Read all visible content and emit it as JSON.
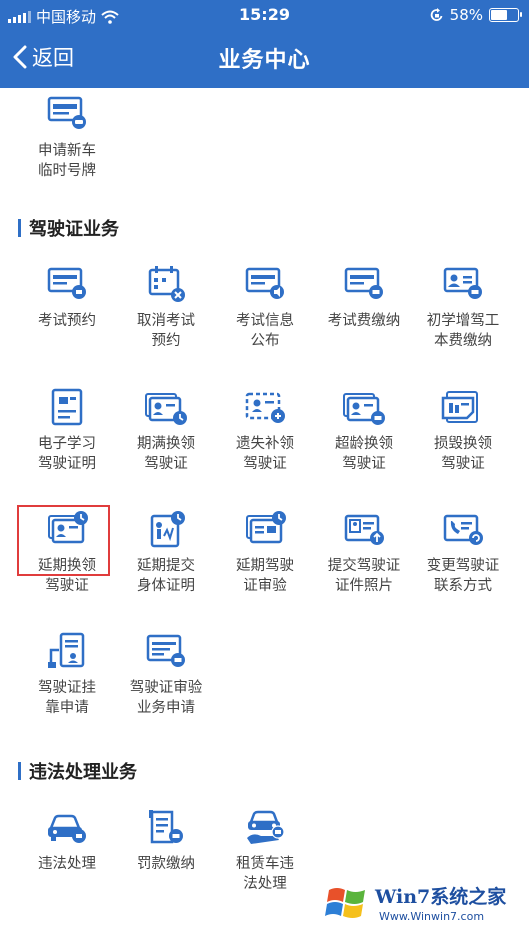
{
  "status_bar": {
    "carrier": "中国移动",
    "time": "15:29",
    "battery_percent": "58%",
    "battery_level": 0.58
  },
  "nav": {
    "back_label": "返回",
    "title": "业务中心"
  },
  "top_items": [
    {
      "label": "申请新车\n临时号牌",
      "icon": "temporary-plate-icon"
    }
  ],
  "sections": [
    {
      "title": "驾驶证业务",
      "items": [
        {
          "label": "考试预约",
          "icon": "exam-appointment-icon"
        },
        {
          "label": "取消考试\n预约",
          "icon": "cancel-exam-icon"
        },
        {
          "label": "考试信息\n公布",
          "icon": "exam-info-icon"
        },
        {
          "label": "考试费缴纳",
          "icon": "exam-fee-icon"
        },
        {
          "label": "初学增驾工\n本费缴纳",
          "icon": "learner-fee-icon"
        },
        {
          "label": "电子学习\n驾驶证明",
          "icon": "e-learning-permit-icon"
        },
        {
          "label": "期满换领\n驾驶证",
          "icon": "expiry-renewal-icon"
        },
        {
          "label": "遗失补领\n驾驶证",
          "icon": "lost-replacement-icon"
        },
        {
          "label": "超龄换领\n驾驶证",
          "icon": "overage-renewal-icon"
        },
        {
          "label": "损毁换领\n驾驶证",
          "icon": "damaged-renewal-icon"
        },
        {
          "label": "延期换领\n驾驶证",
          "icon": "deferred-renewal-icon"
        },
        {
          "label": "延期提交\n身体证明",
          "icon": "deferred-health-icon"
        },
        {
          "label": "延期驾驶\n证审验",
          "icon": "deferred-review-icon"
        },
        {
          "label": "提交驾驶证\n证件照片",
          "icon": "submit-photo-icon"
        },
        {
          "label": "变更驾驶证\n联系方式",
          "icon": "change-contact-icon"
        },
        {
          "label": "驾驶证挂\n靠申请",
          "icon": "affiliation-icon"
        },
        {
          "label": "驾驶证审验\n业务申请",
          "icon": "review-application-icon"
        }
      ]
    },
    {
      "title": "违法处理业务",
      "items": [
        {
          "label": "违法处理",
          "icon": "violation-handling-icon"
        },
        {
          "label": "罚款缴纳",
          "icon": "fine-payment-icon"
        },
        {
          "label": "租赁车违\n法处理",
          "icon": "rental-violation-icon"
        }
      ]
    }
  ],
  "watermark": {
    "brand": "Win7系统之家",
    "url": "Www.Winwin7.com"
  },
  "colors": {
    "header": "#2f6fc6",
    "icon_blue": "#2f6fc6",
    "highlight": "#e03c3c"
  }
}
